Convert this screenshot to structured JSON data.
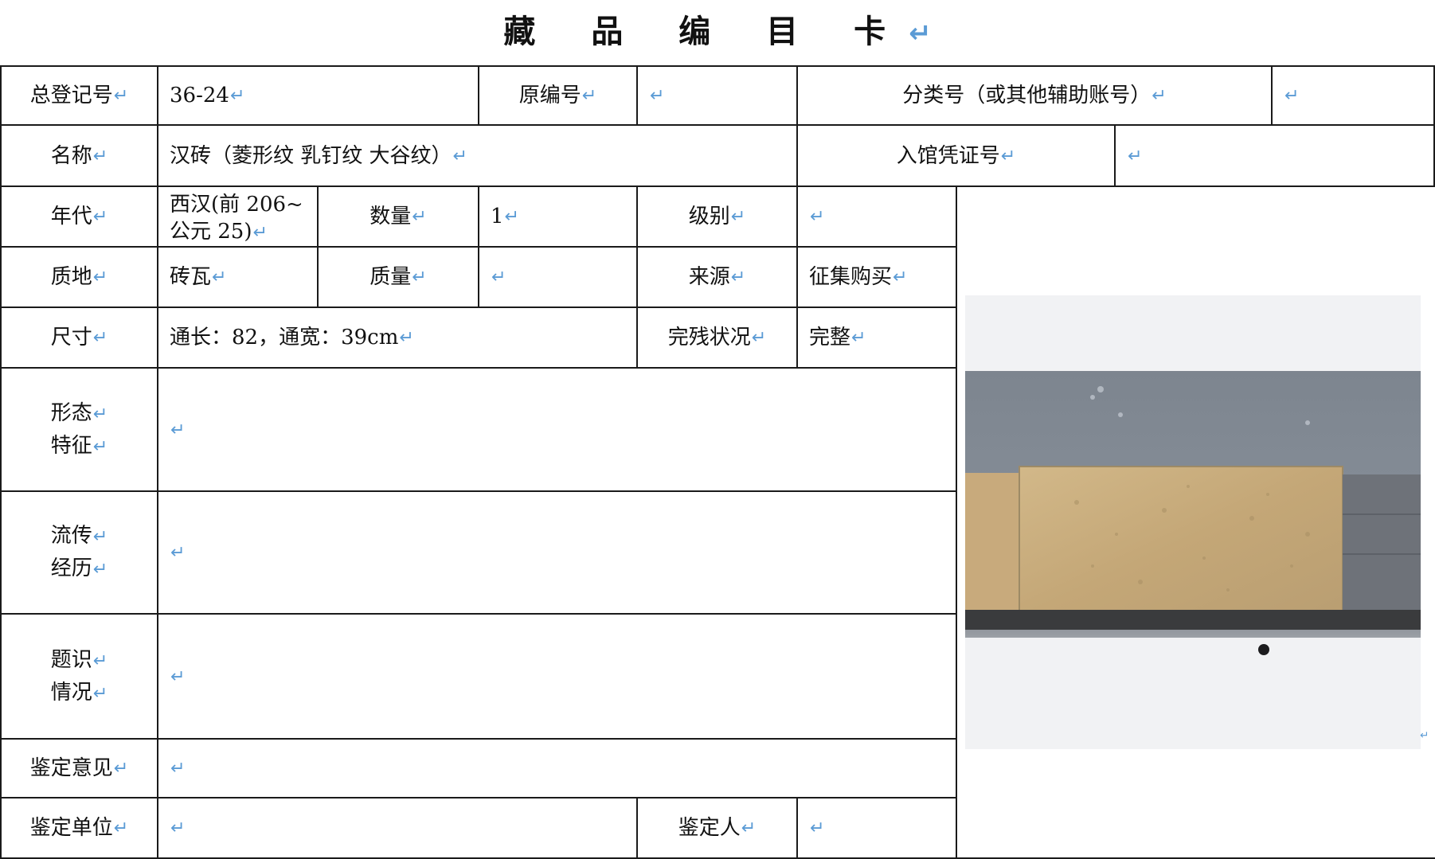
{
  "title": "藏 品 编 目 卡",
  "return_mark": "↵",
  "labels": {
    "reg_no": "总登记号",
    "orig_no": "原编号",
    "class_no": "分类号（或其他辅助账号）",
    "name": "名称",
    "entry_voucher": "入馆凭证号",
    "era": "年代",
    "quantity": "数量",
    "grade": "级别",
    "material": "质地",
    "mass": "质量",
    "source": "来源",
    "size": "尺寸",
    "condition": "完残状况",
    "form_1": "形态",
    "form_2": "特征",
    "history_1": "流传",
    "history_2": "经历",
    "inscription_1": "题识",
    "inscription_2": "情况",
    "appraisal_opinion": "鉴定意见",
    "appraisal_unit": "鉴定单位",
    "appraiser": "鉴定人"
  },
  "values": {
    "reg_no": "36-24",
    "name": "汉砖（菱形纹 乳钉纹 大谷纹）",
    "era_line1": "西汉(前 206~",
    "era_line2": "公元 25)",
    "quantity": "1",
    "material": "砖瓦",
    "source": "征集购买",
    "size": "通长：82，通宽：39cm",
    "condition": "完整"
  },
  "colors": {
    "border": "#1a1a1a",
    "return_mark": "#5b9bd5",
    "photo_bg": "#f1f2f4",
    "wall": "#7f8792",
    "brick": "#c9ac7e",
    "floor": "#8a8e94"
  }
}
